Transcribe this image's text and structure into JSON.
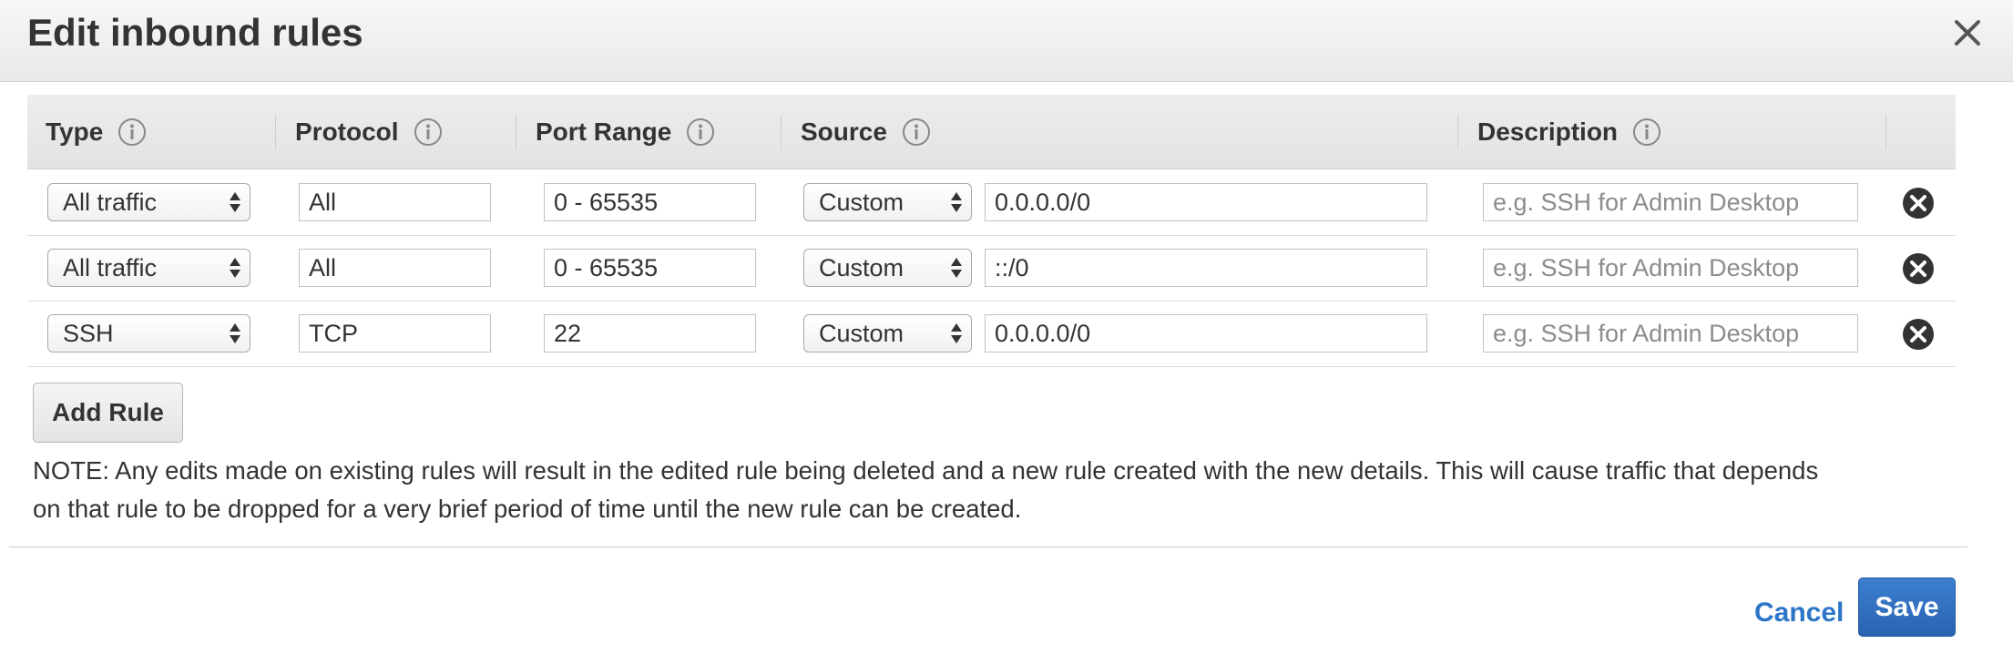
{
  "dialog": {
    "title": "Edit inbound rules"
  },
  "columns": {
    "type": "Type",
    "protocol": "Protocol",
    "port_range": "Port Range",
    "source": "Source",
    "description": "Description"
  },
  "rules": [
    {
      "type": "All traffic",
      "protocol": "All",
      "port_range": "0 - 65535",
      "source_type": "Custom",
      "source_value": "0.0.0.0/0",
      "description_value": "",
      "description_placeholder": "e.g. SSH for Admin Desktop"
    },
    {
      "type": "All traffic",
      "protocol": "All",
      "port_range": "0 - 65535",
      "source_type": "Custom",
      "source_value": "::/0",
      "description_value": "",
      "description_placeholder": "e.g. SSH for Admin Desktop"
    },
    {
      "type": "SSH",
      "protocol": "TCP",
      "port_range": "22",
      "source_type": "Custom",
      "source_value": "0.0.0.0/0",
      "description_value": "",
      "description_placeholder": "e.g. SSH for Admin Desktop"
    }
  ],
  "actions": {
    "add_rule": "Add Rule",
    "cancel": "Cancel",
    "save": "Save"
  },
  "note": {
    "line1": "NOTE: Any edits made on existing rules will result in the edited rule being deleted and a new rule created with the new details. This will cause traffic that depends",
    "line2": "on that rule to be dropped for a very brief period of time until the new rule can be created."
  },
  "icons": {
    "close": "close-icon",
    "info": "info-icon",
    "remove": "remove-rule-icon",
    "select_arrows": "select-arrows-icon"
  },
  "colors": {
    "link": "#2c75c7",
    "primary_button": "#2f6dbf",
    "remove_icon": "#333333"
  }
}
